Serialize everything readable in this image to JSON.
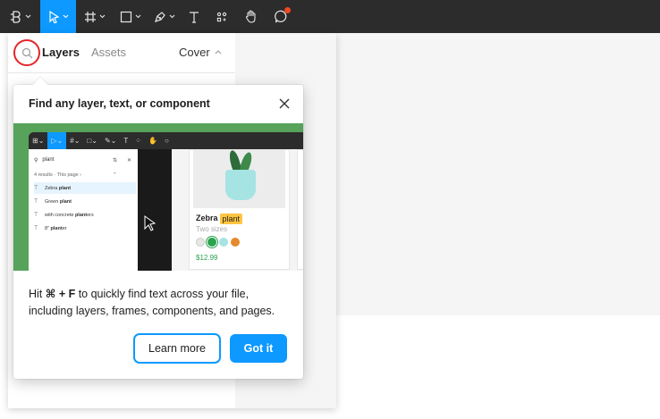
{
  "toolbar": {
    "items": [
      {
        "icon": "main-menu-icon",
        "has_dropdown": true
      },
      {
        "icon": "move-icon",
        "has_dropdown": true,
        "active": true
      },
      {
        "icon": "frame-icon",
        "has_dropdown": true
      },
      {
        "icon": "rectangle-icon",
        "has_dropdown": true
      },
      {
        "icon": "pen-icon",
        "has_dropdown": true
      },
      {
        "icon": "text-icon",
        "label": "T"
      },
      {
        "icon": "resources-icon"
      },
      {
        "icon": "hand-icon"
      },
      {
        "icon": "comment-icon",
        "badge": true
      }
    ]
  },
  "panel": {
    "tab_layers": "Layers",
    "tab_assets": "Assets",
    "page_name": "Cover"
  },
  "popover": {
    "title": "Find any layer, text, or component",
    "body_prefix": "Hit ",
    "shortcut": "⌘ + F",
    "body_suffix": " to quickly find text across your file, including layers, frames, components, and pages.",
    "learn_more": "Learn more",
    "got_it": "Got it",
    "illustration": {
      "search_text": "plant",
      "results_text": "4 results · This page ›",
      "results": [
        {
          "prefix": "Zebra ",
          "match": "plant",
          "suffix": ""
        },
        {
          "prefix": "Green ",
          "match": "plant",
          "suffix": ""
        },
        {
          "prefix": "with concrete ",
          "match": "plant",
          "suffix": "ers"
        },
        {
          "prefix": "8\" ",
          "match": "plant",
          "suffix": "er"
        }
      ],
      "card_name": "Zebra",
      "card_name_match": "plant",
      "card_sub": "Two sizes",
      "card_price": "$12.99",
      "swatches": [
        "#e6e6e6",
        "#29a34e",
        "#a6e3e3",
        "#e58a2c"
      ]
    }
  },
  "colors": {
    "accent": "#0d99ff",
    "toolbar_bg": "#2c2c2c",
    "highlight_ring": "#e3262b",
    "illustration_bg": "#57a35b"
  }
}
